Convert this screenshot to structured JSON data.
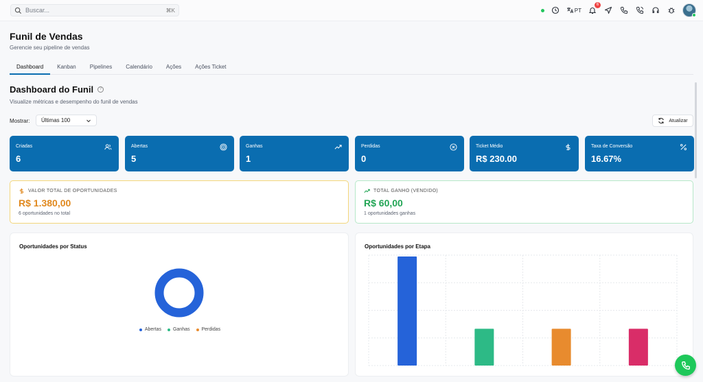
{
  "search": {
    "placeholder": "Buscar...",
    "shortcut": "⌘K"
  },
  "topbar": {
    "language": "PT",
    "notification_count": "6"
  },
  "page": {
    "title": "Funil de Vendas",
    "subtitle": "Gerencie seu pipeline de vendas"
  },
  "tabs": [
    {
      "label": "Dashboard",
      "active": true
    },
    {
      "label": "Kanban"
    },
    {
      "label": "Pipelines"
    },
    {
      "label": "Calendário"
    },
    {
      "label": "Ações"
    },
    {
      "label": "Ações Ticket"
    }
  ],
  "dashboard": {
    "title": "Dashboard do Funil",
    "subtitle": "Visualize métricas e desempenho do funil de vendas",
    "show_label": "Mostrar:",
    "show_value": "Últimas 100",
    "refresh_label": "Atualizar"
  },
  "stats": [
    {
      "label": "Criadas",
      "value": "6",
      "icon": "users-icon"
    },
    {
      "label": "Abertas",
      "value": "5",
      "icon": "target-icon"
    },
    {
      "label": "Ganhas",
      "value": "1",
      "icon": "trending-up-icon"
    },
    {
      "label": "Perdidas",
      "value": "0",
      "icon": "x-circle-icon"
    },
    {
      "label": "Ticket Médio",
      "value": "R$ 230.00",
      "icon": "dollar-icon"
    },
    {
      "label": "Taxa de Conversão",
      "value": "16.67%",
      "icon": "percent-icon"
    }
  ],
  "summary": {
    "total": {
      "label": "VALOR TOTAL DE OPORTUNIDADES",
      "value": "R$ 1.380,00",
      "note": "6 oportunidades no total"
    },
    "won": {
      "label": "TOTAL GANHO (VENDIDO)",
      "value": "R$ 60,00",
      "note": "1 oportunidades ganhas"
    }
  },
  "colors": {
    "primary": "#0a6db0",
    "blue": "#2563d9",
    "green": "#2dba86",
    "orange": "#e88b2e",
    "pink": "#d92d68"
  },
  "chart_data": [
    {
      "type": "pie",
      "title": "Oportunidades por Status",
      "categories": [
        "Abertas",
        "Ganhas",
        "Perdidas"
      ],
      "values": [
        5,
        0,
        0
      ],
      "colors": [
        "#2563d9",
        "#2dba86",
        "#e88b2e"
      ],
      "legend": "bottom"
    },
    {
      "type": "bar",
      "title": "Oportunidades por Etapa",
      "categories": [
        "",
        "",
        "",
        ""
      ],
      "values": [
        4,
        1.35,
        1.35,
        1.35
      ],
      "colors": [
        "#2563d9",
        "#2dba86",
        "#e88b2e",
        "#d92d68"
      ],
      "ylim": [
        0,
        4.05
      ],
      "grid": true
    }
  ]
}
